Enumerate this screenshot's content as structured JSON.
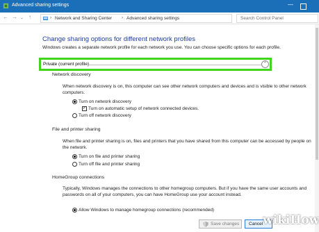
{
  "window": {
    "title": "Advanced sharing settings",
    "minimize_glyph": "—"
  },
  "address_bar": {
    "back": "←",
    "forward": "→",
    "up": "↑",
    "breadcrumbs": [
      "Network and Sharing Center",
      "Advanced sharing settings"
    ],
    "separator": "›",
    "search_placeholder": "Search Control Panel"
  },
  "main": {
    "heading": "Change sharing options for different network profiles",
    "intro": "Windows creates a separate network profile for each network you use. You can choose specific options for each profile.",
    "profile": {
      "title": "Private (current profile)",
      "collapse_glyph": "⌃",
      "highlight_color": "#41d51d"
    },
    "network_discovery": {
      "title": "Network discovery",
      "description": "When network discovery is on, this computer can see other network computers and devices and is visible to other network computers.",
      "options": [
        "Turn on network discovery",
        "Turn off network discovery"
      ],
      "selected": 0,
      "auto_setup": {
        "label": "Turn on automatic setup of network connected devices.",
        "checked": true,
        "mark": "✓"
      }
    },
    "file_printer_sharing": {
      "title": "File and printer sharing",
      "description": "When file and printer sharing is on, files and printers that you have shared from this computer can be accessed by people on the network.",
      "options": [
        "Turn on file and printer sharing",
        "Turn off file and printer sharing"
      ],
      "selected": 0
    },
    "homegroup": {
      "title": "HomeGroup connections",
      "description": "Typically, Windows manages the connections to other homegroup computers. But if you have the same user accounts and passwords on all of your computers, you can have HomeGroup use your account instead.",
      "options": [
        "Allow Windows to manage homegroup connections (recommended)"
      ],
      "selected": 0
    }
  },
  "footer": {
    "save_label": "Save changes",
    "cancel_label": "Cancel"
  },
  "watermark": "wikiHow",
  "colors": {
    "titlebar": "#1a6fb8",
    "heading": "#1e3f9c"
  }
}
